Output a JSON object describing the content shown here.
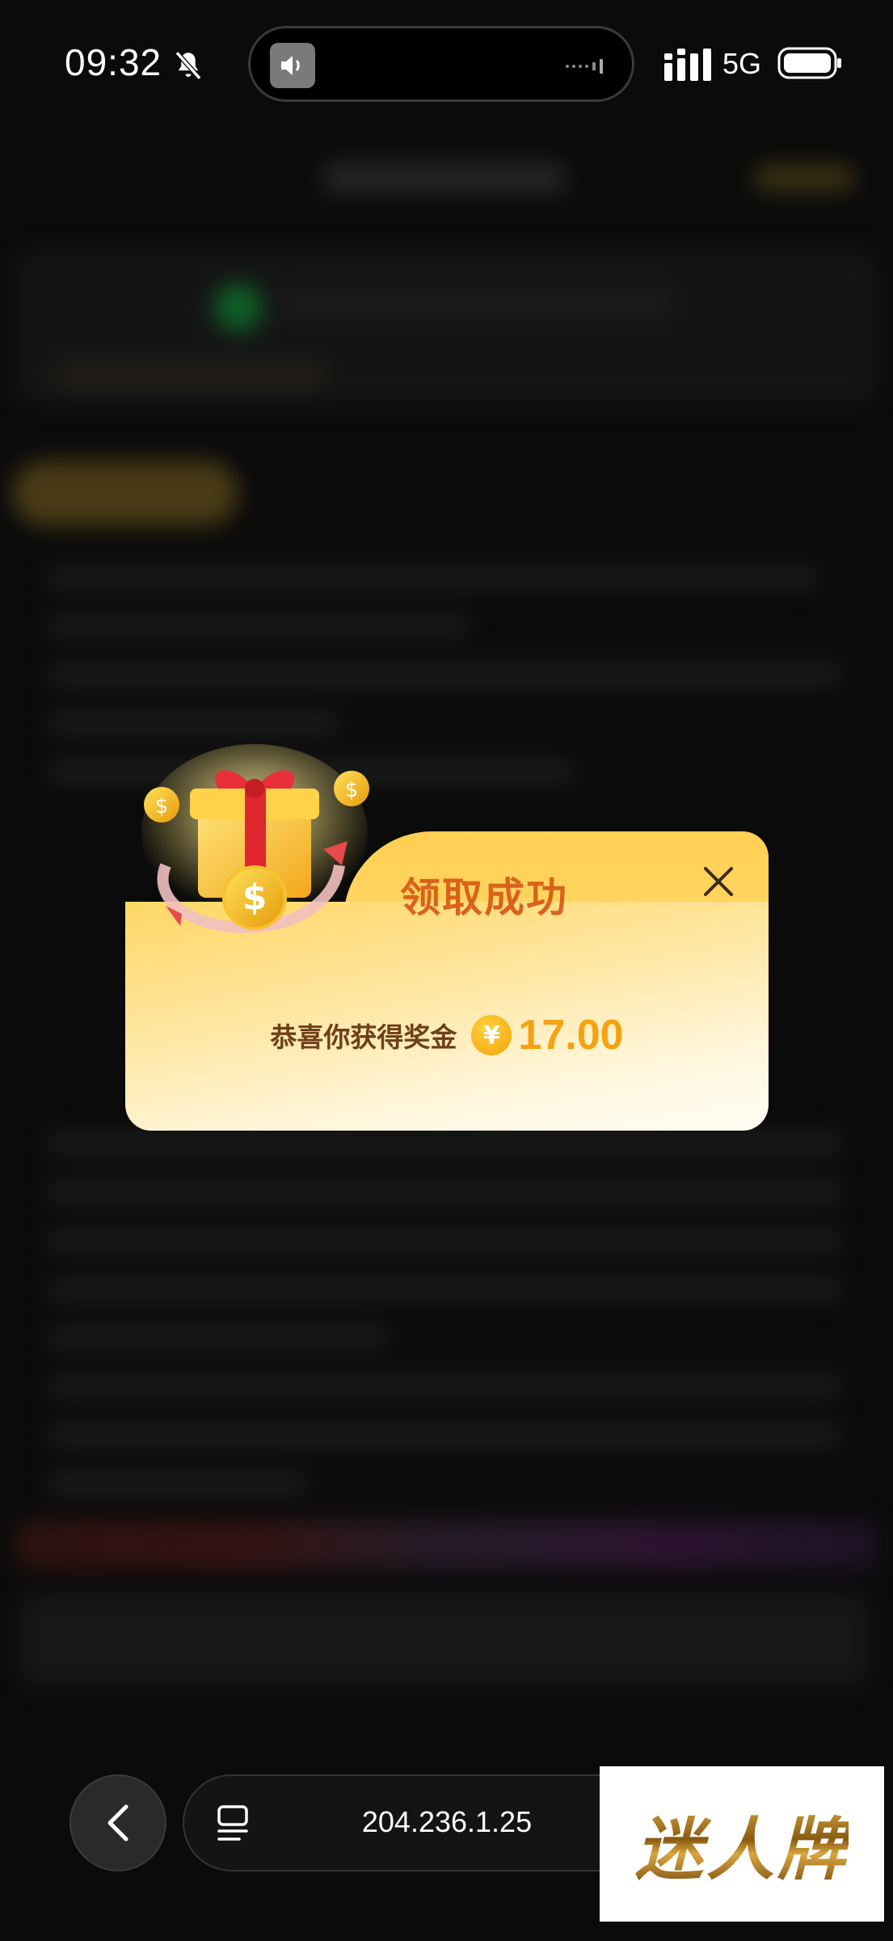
{
  "status_bar": {
    "time": "09:32",
    "network": "5G",
    "icons": [
      "bell-muted-icon",
      "speaker-icon",
      "signal-icon",
      "battery-icon"
    ]
  },
  "modal": {
    "title": "领取成功",
    "prize_label": "恭喜你获得奖金",
    "currency_symbol": "¥",
    "amount": "17.00",
    "icons": [
      "gift-box-icon",
      "coin-icon",
      "close-icon"
    ],
    "colors": {
      "title": "#d9631b",
      "amount": "#f5a212",
      "panel": "#ffd766"
    }
  },
  "browser": {
    "url": "204.236.1.25",
    "icons": [
      "back-arrow-icon",
      "tabs-icon"
    ]
  },
  "watermark": {
    "text": "迷人牌"
  }
}
